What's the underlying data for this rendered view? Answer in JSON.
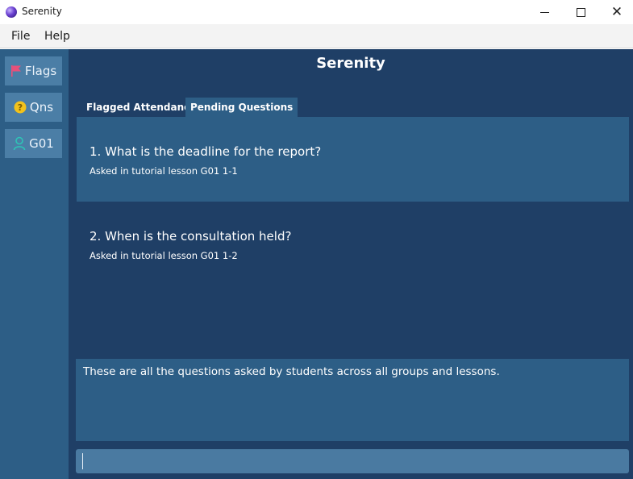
{
  "window": {
    "title": "Serenity",
    "icon": "app-logo-icon"
  },
  "menu": {
    "items": [
      "File",
      "Help"
    ]
  },
  "sidebar": {
    "items": [
      {
        "label": "Flags",
        "icon": "flag-icon",
        "icon_color": "#e8507a"
      },
      {
        "label": "Qns",
        "icon": "question-icon",
        "icon_color": "#f2c21b"
      },
      {
        "label": "G01",
        "icon": "person-icon",
        "icon_color": "#2ec4b6"
      }
    ]
  },
  "main": {
    "title": "Serenity",
    "tabs": [
      {
        "label": "Flagged Attendance",
        "selected": false
      },
      {
        "label": "Pending Questions",
        "selected": true
      }
    ],
    "questions": [
      {
        "text": "1.  What is the deadline for the report?",
        "sub": "Asked in tutorial lesson G01 1-1"
      },
      {
        "text": "2.  When is the consultation held?",
        "sub": "Asked in tutorial lesson G01 1-2"
      }
    ],
    "info": "These are all the questions asked by students across all groups and lessons.",
    "command_input": {
      "value": "",
      "placeholder": ""
    }
  },
  "colors": {
    "sidebar_bg": "#2d5e86",
    "main_bg": "#1f3f66",
    "button_bg": "#4b7ea6",
    "input_bg": "#4a7aa1"
  }
}
